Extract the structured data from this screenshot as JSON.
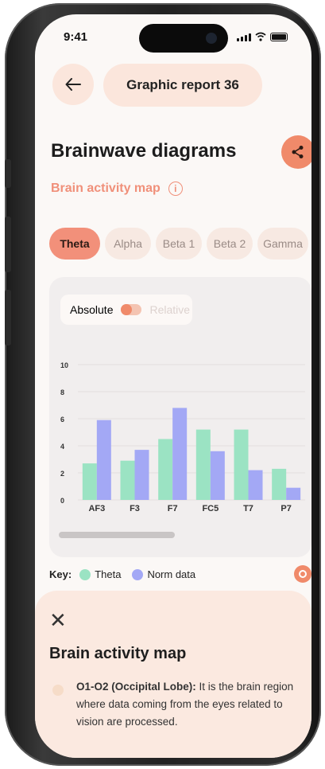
{
  "status": {
    "time": "9:41"
  },
  "header": {
    "title": "Graphic report 36"
  },
  "page": {
    "heading": "Brainwave diagrams",
    "subheading": "Brain activity map"
  },
  "tabs": [
    {
      "label": "Theta",
      "active": true
    },
    {
      "label": "Alpha",
      "active": false
    },
    {
      "label": "Beta 1",
      "active": false
    },
    {
      "label": "Beta 2",
      "active": false
    },
    {
      "label": "Gamma",
      "active": false
    }
  ],
  "toggle": {
    "left_label": "Absolute",
    "right_label": "Relative",
    "selected": "Absolute"
  },
  "chart_data": {
    "type": "bar",
    "categories": [
      "AF3",
      "F3",
      "F7",
      "FC5",
      "T7",
      "P7"
    ],
    "series": [
      {
        "name": "Theta",
        "values": [
          2.7,
          2.9,
          4.5,
          5.2,
          5.2,
          2.3
        ],
        "color": "#9be3c3"
      },
      {
        "name": "Norm data",
        "values": [
          5.9,
          3.7,
          6.8,
          3.6,
          2.2,
          0.9
        ],
        "color": "#a3a8f5"
      }
    ],
    "yticks": [
      0,
      2,
      4,
      6,
      8,
      10
    ],
    "ylim": [
      0,
      10
    ],
    "grid": true
  },
  "legend": {
    "key_label": "Key:",
    "items": [
      "Theta",
      "Norm data"
    ]
  },
  "sheet": {
    "title": "Brain activity map",
    "item_label": "O1-O2 (Occipital Lobe):",
    "item_text": " It is the brain region where data coming from the eyes related to vision are processed."
  }
}
